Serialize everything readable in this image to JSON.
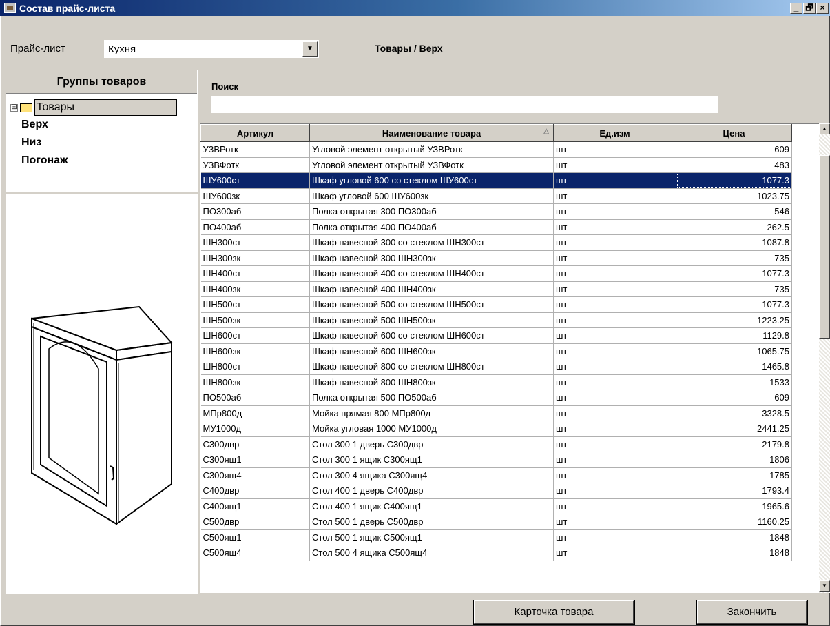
{
  "window": {
    "title": "Состав прайс-листа",
    "minimize": "_",
    "restore": "🗗",
    "close": "×"
  },
  "pricelist": {
    "label": "Прайс-лист",
    "selected": "Кухня",
    "arrow": "▼"
  },
  "path_label": "Товары / Верх",
  "groups": {
    "header": "Группы товаров",
    "expander": "⊟",
    "root": "Товары",
    "children": [
      "Верх",
      "Низ",
      "Погонаж"
    ]
  },
  "search": {
    "label": "Поиск",
    "value": ""
  },
  "table": {
    "columns": [
      "Артикул",
      "Наименование товара",
      "Ед.изм",
      "Цена"
    ],
    "sort_indicator": "△",
    "selected_index": 2,
    "rows": [
      {
        "sku": "УЗВРотк",
        "name": "Угловой элемент открытый УЗВРотк",
        "unit": "шт",
        "price": "609"
      },
      {
        "sku": "УЗВФотк",
        "name": "Угловой элемент открытый УЗВФотк",
        "unit": "шт",
        "price": "483"
      },
      {
        "sku": "ШУ600ст",
        "name": "Шкаф угловой 600 со стеклом ШУ600ст",
        "unit": "шт",
        "price": "1077.3"
      },
      {
        "sku": "ШУ600зк",
        "name": "Шкаф угловой 600 ШУ600зк",
        "unit": "шт",
        "price": "1023.75"
      },
      {
        "sku": "ПО300аб",
        "name": "Полка открытая 300 ПО300аб",
        "unit": "шт",
        "price": "546"
      },
      {
        "sku": "ПО400аб",
        "name": "Полка открытая 400 ПО400аб",
        "unit": "шт",
        "price": "262.5"
      },
      {
        "sku": "ШН300ст",
        "name": "Шкаф навесной 300 со стеклом ШН300ст",
        "unit": "шт",
        "price": "1087.8"
      },
      {
        "sku": "ШН300зк",
        "name": "Шкаф навесной 300 ШН300зк",
        "unit": "шт",
        "price": "735"
      },
      {
        "sku": "ШН400ст",
        "name": "Шкаф навесной 400 со стеклом ШН400ст",
        "unit": "шт",
        "price": "1077.3"
      },
      {
        "sku": "ШН400зк",
        "name": "Шкаф навесной 400 ШН400зк",
        "unit": "шт",
        "price": "735"
      },
      {
        "sku": "ШН500ст",
        "name": "Шкаф навесной 500 со стеклом ШН500ст",
        "unit": "шт",
        "price": "1077.3"
      },
      {
        "sku": "ШН500зк",
        "name": "Шкаф навесной 500 ШН500зк",
        "unit": "шт",
        "price": "1223.25"
      },
      {
        "sku": "ШН600ст",
        "name": "Шкаф навесной 600 со стеклом ШН600ст",
        "unit": "шт",
        "price": "1129.8"
      },
      {
        "sku": "ШН600зк",
        "name": "Шкаф навесной 600 ШН600зк",
        "unit": "шт",
        "price": "1065.75"
      },
      {
        "sku": "ШН800ст",
        "name": "Шкаф навесной 800 со стеклом ШН800ст",
        "unit": "шт",
        "price": "1465.8"
      },
      {
        "sku": "ШН800зк",
        "name": "Шкаф навесной 800 ШН800зк",
        "unit": "шт",
        "price": "1533"
      },
      {
        "sku": "ПО500аб",
        "name": "Полка открытая 500 ПО500аб",
        "unit": "шт",
        "price": "609"
      },
      {
        "sku": "МПр800д",
        "name": "Мойка прямая 800 МПр800д",
        "unit": "шт",
        "price": "3328.5"
      },
      {
        "sku": "МУ1000д",
        "name": "Мойка угловая 1000 МУ1000д",
        "unit": "шт",
        "price": "2441.25"
      },
      {
        "sku": "С300двр",
        "name": "Стол 300 1 дверь С300двр",
        "unit": "шт",
        "price": "2179.8"
      },
      {
        "sku": "С300ящ1",
        "name": "Стол 300 1 ящик С300ящ1",
        "unit": "шт",
        "price": "1806"
      },
      {
        "sku": "С300ящ4",
        "name": "Стол 300 4 ящика С300ящ4",
        "unit": "шт",
        "price": "1785"
      },
      {
        "sku": "С400двр",
        "name": "Стол 400 1 дверь С400двр",
        "unit": "шт",
        "price": "1793.4"
      },
      {
        "sku": "С400ящ1",
        "name": "Стол 400 1 ящик С400ящ1",
        "unit": "шт",
        "price": "1965.6"
      },
      {
        "sku": "С500двр",
        "name": "Стол 500 1 дверь С500двр",
        "unit": "шт",
        "price": "1160.25"
      },
      {
        "sku": "С500ящ1",
        "name": "Стол 500 1 ящик С500ящ1",
        "unit": "шт",
        "price": "1848"
      },
      {
        "sku": "С500ящ4",
        "name": "Стол 500 4 ящика С500ящ4",
        "unit": "шт",
        "price": "1848"
      }
    ]
  },
  "scrollbar": {
    "up": "▲",
    "down": "▼"
  },
  "buttons": {
    "card": "Карточка товара",
    "finish": "Закончить"
  }
}
